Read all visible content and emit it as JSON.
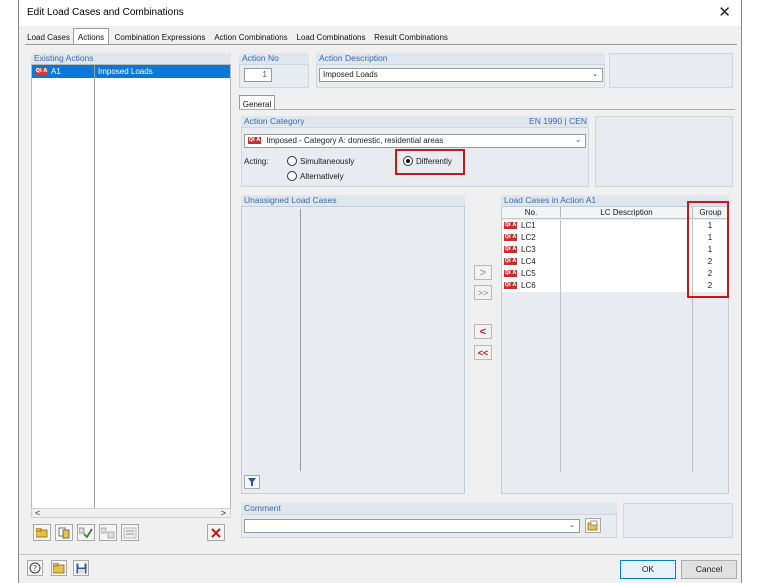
{
  "window": {
    "title": "Edit Load Cases and Combinations",
    "close_label": "✕"
  },
  "tabs": [
    {
      "label": "Load Cases"
    },
    {
      "label": "Actions"
    },
    {
      "label": "Combination Expressions"
    },
    {
      "label": "Action Combinations"
    },
    {
      "label": "Load Combinations"
    },
    {
      "label": "Result Combinations"
    }
  ],
  "existing_actions": {
    "title": "Existing Actions",
    "items": [
      {
        "badge": "Qi A",
        "id": "A1",
        "name": "Imposed Loads"
      }
    ]
  },
  "action_no": {
    "label": "Action No",
    "value": "1"
  },
  "action_description": {
    "label": "Action Description",
    "value": "Imposed Loads"
  },
  "general_tab": {
    "label": "General"
  },
  "action_category": {
    "label": "Action Category",
    "standard": "EN 1990 | CEN",
    "badge": "Qi A",
    "value": "Imposed - Category A: domestic, residential areas"
  },
  "acting": {
    "label": "Acting:",
    "options": [
      {
        "label": "Simultaneously",
        "selected": false
      },
      {
        "label": "Alternatively",
        "selected": false
      },
      {
        "label": "Differently",
        "selected": true
      }
    ]
  },
  "unassigned": {
    "title": "Unassigned Load Cases"
  },
  "assigned": {
    "title": "Load Cases in Action A1",
    "columns": [
      "No.",
      "LC Description",
      "Group"
    ],
    "rows": [
      {
        "badge": "Qi A",
        "no": "LC1",
        "desc": "",
        "group": "1"
      },
      {
        "badge": "Qi A",
        "no": "LC2",
        "desc": "",
        "group": "1"
      },
      {
        "badge": "Qi A",
        "no": "LC3",
        "desc": "",
        "group": "1"
      },
      {
        "badge": "Qi A",
        "no": "LC4",
        "desc": "",
        "group": "2"
      },
      {
        "badge": "Qi A",
        "no": "LC5",
        "desc": "",
        "group": "2"
      },
      {
        "badge": "Qi A",
        "no": "LC6",
        "desc": "",
        "group": "2"
      }
    ]
  },
  "move_buttons": {
    "add": ">",
    "add_all": ">>",
    "remove": "<",
    "remove_all": "<<"
  },
  "comment": {
    "label": "Comment",
    "value": ""
  },
  "buttons": {
    "ok": "OK",
    "cancel": "Cancel"
  },
  "colors": {
    "accent": "#0a78d7",
    "badge": "#c8312f",
    "highlight": "#c8181c",
    "group_title": "#3a6aa8"
  },
  "scroll": {
    "left": "<",
    "right": ">"
  }
}
